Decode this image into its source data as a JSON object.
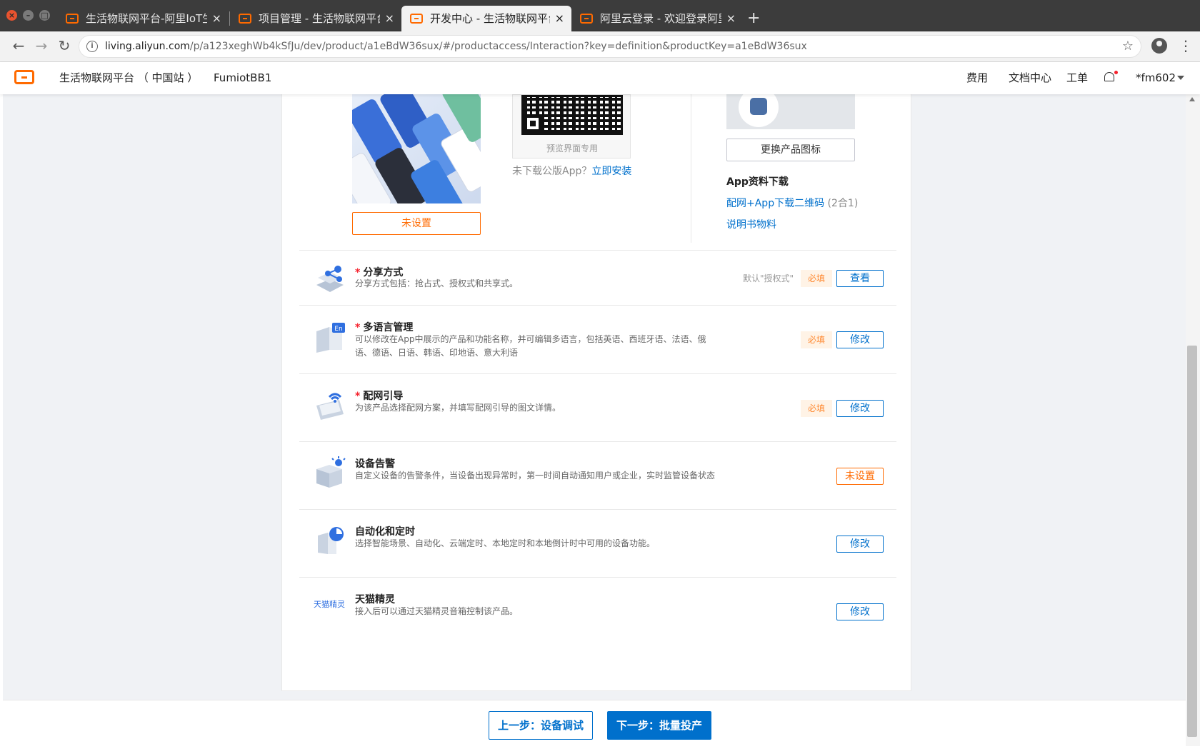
{
  "browser": {
    "tabs": [
      {
        "title": "生活物联网平台-阿里IoT生",
        "active": false
      },
      {
        "title": "项目管理 - 生活物联网平台",
        "active": false
      },
      {
        "title": "开发中心 - 生活物联网平台",
        "active": true
      },
      {
        "title": "阿里云登录 - 欢迎登录阿里",
        "active": false
      }
    ],
    "new_tab": "+",
    "url_host": "living.aliyun.com",
    "url_path": "/p/a123xeghWb4kSfJu/dev/product/a1eBdW36sux/#/productaccess/Interaction?key=definition&productKey=a1eBdW36sux"
  },
  "header": {
    "platform": "生活物联网平台 （ 中国站 ）",
    "project": "FumiotBB1",
    "nav": [
      "费用",
      "文档中心",
      "工单"
    ],
    "user": "*fm602"
  },
  "top": {
    "unset_label": "未设置",
    "qr_caption": "预览界面专用",
    "no_install_text": "未下载公版App？",
    "install_link": "立即安装",
    "change_icon_label": "更换产品图标",
    "download_title": "App资料下载",
    "download_link1": "配网+App下载二维码",
    "download_link1_suffix": " (2合1)",
    "download_link2": "说明书物料"
  },
  "rows": [
    {
      "title": "分享方式",
      "required": true,
      "desc": "分享方式包括：抢占式、授权式和共享式。",
      "hint": "默认\"授权式\"",
      "badge": "必填",
      "button": "查看",
      "button_style": "blue"
    },
    {
      "title": "多语言管理",
      "required": true,
      "desc": "可以修改在App中展示的产品和功能名称，并可编辑多语言，包括英语、西班牙语、法语、俄语、德语、日语、韩语、印地语、意大利语",
      "hint": "",
      "badge": "必填",
      "button": "修改",
      "button_style": "blue"
    },
    {
      "title": "配网引导",
      "required": true,
      "desc": "为该产品选择配网方案，并填写配网引导的图文详情。",
      "hint": "",
      "badge": "必填",
      "button": "修改",
      "button_style": "blue"
    },
    {
      "title": "设备告警",
      "required": false,
      "desc": "自定义设备的告警条件，当设备出现异常时，第一时间自动通知用户或企业，实时监管设备状态",
      "hint": "",
      "badge": "",
      "button": "未设置",
      "button_style": "orange"
    },
    {
      "title": "自动化和定时",
      "required": false,
      "desc": "选择智能场景、自动化、云端定时、本地定时和本地倒计时中可用的设备功能。",
      "hint": "",
      "badge": "",
      "button": "修改",
      "button_style": "blue"
    },
    {
      "title": "天猫精灵",
      "required": false,
      "desc": "接入后可以通过天猫精灵音箱控制该产品。",
      "hint": "",
      "badge": "",
      "button": "修改",
      "button_style": "blue",
      "icon_text": "天猫精灵"
    }
  ],
  "footer": {
    "prev": "上一步：设备调试",
    "next": "下一步：批量投产"
  },
  "colors": {
    "brand": "#ff6a00",
    "link": "#0070cc",
    "required_bg": "#fff3e6"
  }
}
